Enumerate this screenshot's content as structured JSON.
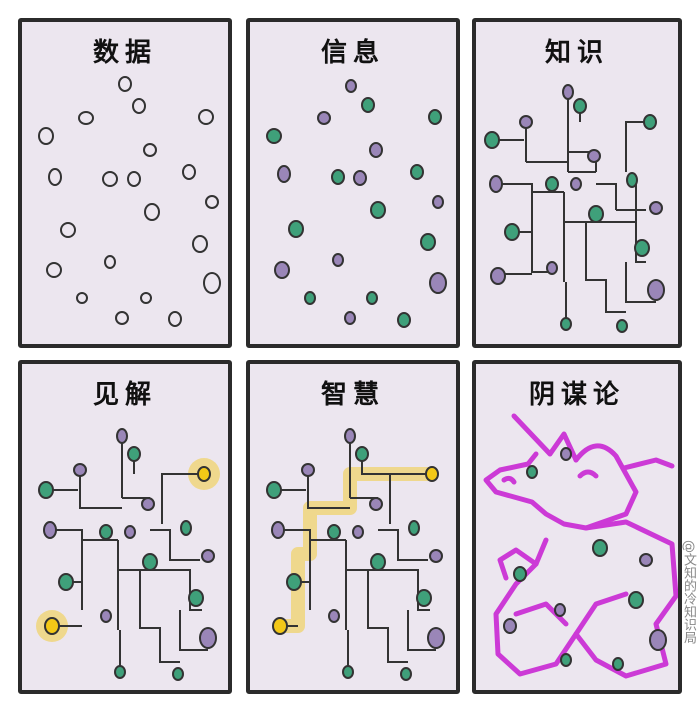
{
  "panels": [
    {
      "title": "数据"
    },
    {
      "title": "信息"
    },
    {
      "title": "知识"
    },
    {
      "title": "见解"
    },
    {
      "title": "智慧"
    },
    {
      "title": "阴谋论"
    }
  ],
  "watermark": "@文知的冷知识局",
  "colors": {
    "panel_bg": "#ece6ef",
    "border": "#2b2b2b",
    "green_dot": "#3fa07a",
    "purple_dot": "#9a86b8",
    "highlight": "#f3c817",
    "conspiracy": "#cc3ad6"
  }
}
